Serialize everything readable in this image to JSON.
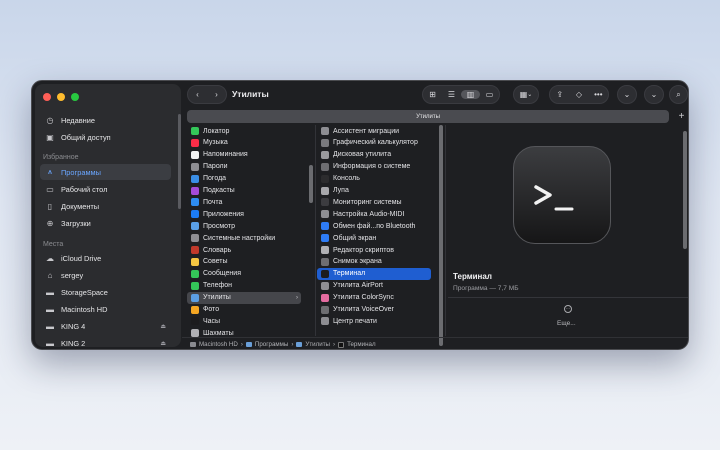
{
  "colors": {
    "close": "#ff5f57",
    "minimize": "#febc2e",
    "zoom": "#28c840",
    "accent": "#1f5ed1",
    "sidebar_active": "#6aa6ff"
  },
  "toolbar": {
    "title": "Утилиты",
    "back_icon": "chevron-left-icon",
    "forward_icon": "chevron-right-icon"
  },
  "tab": {
    "label": "Утилиты",
    "add_icon": "plus-icon"
  },
  "sidebar": {
    "top_items": [
      {
        "label": "Недавние",
        "icon": "clock-icon"
      },
      {
        "label": "Общий доступ",
        "icon": "shared-folder-icon"
      }
    ],
    "favorites_header": "Избранное",
    "favorites": [
      {
        "label": "Программы",
        "icon": "applications-icon",
        "active": true
      },
      {
        "label": "Рабочий стол",
        "icon": "desktop-icon"
      },
      {
        "label": "Документы",
        "icon": "document-icon"
      },
      {
        "label": "Загрузки",
        "icon": "download-icon"
      }
    ],
    "locations_header": "Места",
    "locations": [
      {
        "label": "iCloud Drive",
        "icon": "cloud-icon"
      },
      {
        "label": "sergey",
        "icon": "home-icon"
      },
      {
        "label": "StorageSpace",
        "icon": "disk-icon"
      },
      {
        "label": "Macintosh HD",
        "icon": "disk-icon"
      },
      {
        "label": "KING 4",
        "icon": "disk-icon",
        "eject": true
      },
      {
        "label": "KING 2",
        "icon": "disk-icon",
        "eject": true
      }
    ]
  },
  "column1": [
    {
      "label": "Локатор",
      "color": "#34c759"
    },
    {
      "label": "Музыка",
      "color": "#fa2d48"
    },
    {
      "label": "Напоминания",
      "color": "#f2f2f2"
    },
    {
      "label": "Пароли",
      "color": "#8e8e93"
    },
    {
      "label": "Погода",
      "color": "#3a8ee6"
    },
    {
      "label": "Подкасты",
      "color": "#a44bd8"
    },
    {
      "label": "Почта",
      "color": "#2e8cf0"
    },
    {
      "label": "Приложения",
      "color": "#1c7cf5"
    },
    {
      "label": "Просмотр",
      "color": "#5aa0e8"
    },
    {
      "label": "Системные настройки",
      "color": "#8e8e93"
    },
    {
      "label": "Словарь",
      "color": "#c0392b"
    },
    {
      "label": "Советы",
      "color": "#f5c542"
    },
    {
      "label": "Сообщения",
      "color": "#34c759"
    },
    {
      "label": "Телефон",
      "color": "#34c759"
    },
    {
      "label": "Утилиты",
      "color": "#5b9ee3",
      "selected": true,
      "folder": true
    },
    {
      "label": "Фото",
      "color": "#f5a623"
    },
    {
      "label": "Часы",
      "color": "#1c1c1e"
    },
    {
      "label": "Шахматы",
      "color": "#b0b0b4"
    }
  ],
  "column2": [
    {
      "label": "Ассистент миграции",
      "color": "#8e8e93"
    },
    {
      "label": "Графический калькулятор",
      "color": "#7a7a7e"
    },
    {
      "label": "Дисковая утилита",
      "color": "#9a9a9e"
    },
    {
      "label": "Информация о системе",
      "color": "#6e6e72"
    },
    {
      "label": "Консоль",
      "color": "#2c2c2e"
    },
    {
      "label": "Лупа",
      "color": "#a8a8ac"
    },
    {
      "label": "Мониторинг системы",
      "color": "#3c3c40"
    },
    {
      "label": "Настройка Audio-MIDI",
      "color": "#8e8e93"
    },
    {
      "label": "Обмен фай...по Bluetooth",
      "color": "#2e7cf6"
    },
    {
      "label": "Общий экран",
      "color": "#2e7cf6"
    },
    {
      "label": "Редактор скриптов",
      "color": "#b0b0b4"
    },
    {
      "label": "Снимок экрана",
      "color": "#6e6e72"
    },
    {
      "label": "Терминал",
      "color": "#1c1c1e",
      "selected": true
    },
    {
      "label": "Утилита AirPort",
      "color": "#8e8e93"
    },
    {
      "label": "Утилита ColorSync",
      "color": "#e46ba0"
    },
    {
      "label": "Утилита VoiceOver",
      "color": "#6e6e72"
    },
    {
      "label": "Центр печати",
      "color": "#8e8e93"
    }
  ],
  "preview": {
    "name": "Терминал",
    "subtitle": "Программа — 7,7 МБ",
    "more_label": "Еще...",
    "icon": "terminal-icon"
  },
  "pathbar": [
    {
      "label": "Macintosh HD",
      "icon": "disk-icon"
    },
    {
      "label": "Программы",
      "icon": "folder-icon"
    },
    {
      "label": "Утилиты",
      "icon": "folder-icon"
    },
    {
      "label": "Терминал",
      "icon": "terminal-icon"
    }
  ]
}
